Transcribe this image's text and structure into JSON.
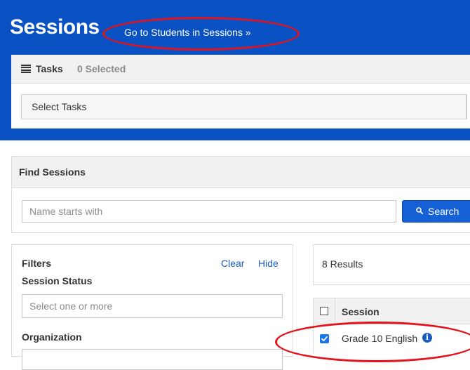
{
  "header": {
    "title": "Sessions",
    "students_link": "Go to Students in Sessions »"
  },
  "tasks": {
    "label": "Tasks",
    "selected_count": "0 Selected",
    "select_placeholder": "Select Tasks"
  },
  "find": {
    "title": "Find Sessions",
    "input_placeholder": "Name starts with",
    "search_button": "Search"
  },
  "filters": {
    "title": "Filters",
    "clear": "Clear",
    "hide": "Hide",
    "status_label": "Session Status",
    "status_placeholder": "Select one or more",
    "org_label": "Organization"
  },
  "results": {
    "count": "8 Results",
    "column_session": "Session",
    "rows": [
      {
        "name": "Grade 10 English",
        "checked": true
      }
    ]
  },
  "colors": {
    "header_blue": "#0a51c4",
    "button_blue": "#1560d4",
    "annotation_red": "#e5121b"
  }
}
